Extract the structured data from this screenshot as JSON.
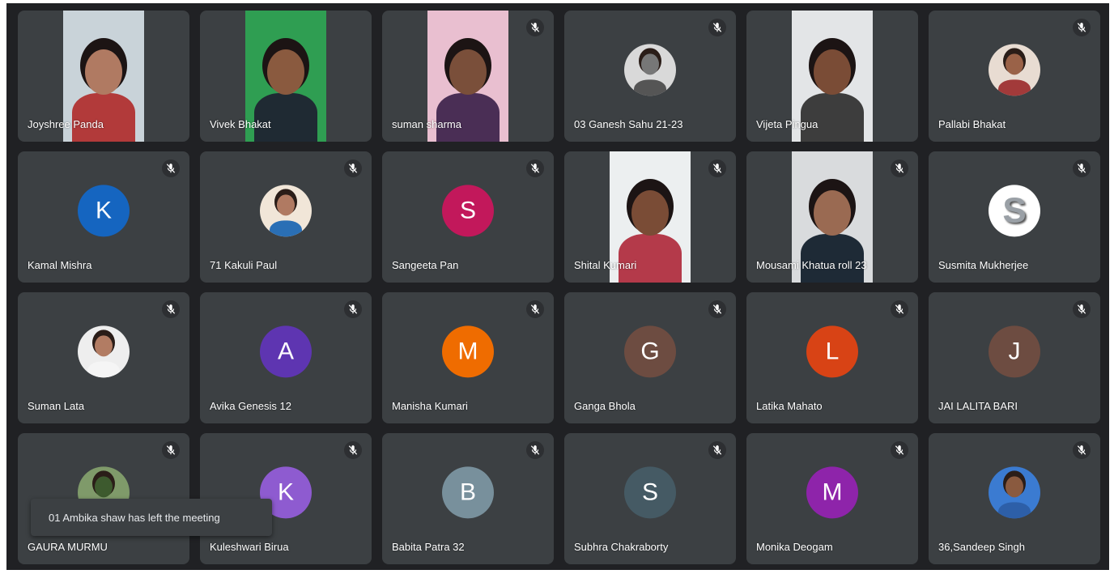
{
  "participants": [
    {
      "name": "Joyshree Panda",
      "type": "video",
      "muted": false,
      "bg": "#c9d3d9",
      "skin": "#b07a62",
      "shirt": "#b23a3a"
    },
    {
      "name": "Vivek Bhakat",
      "type": "video",
      "muted": false,
      "bg": "#2f9e52",
      "skin": "#8a5a3f",
      "shirt": "#1f2a33"
    },
    {
      "name": "suman sharma",
      "type": "video",
      "muted": true,
      "bg": "#e9bfd0",
      "skin": "#7a4f3a",
      "shirt": "#4a2e55"
    },
    {
      "name": "03 Ganesh Sahu 21-23",
      "type": "photo",
      "muted": true,
      "bg": "#d9d9d9",
      "skin": "#777777",
      "shirt": "#555555"
    },
    {
      "name": "Vijeta Pingua",
      "type": "video",
      "muted": false,
      "bg": "#e3e5e7",
      "skin": "#7a4c36",
      "shirt": "#3d3d3d"
    },
    {
      "name": "Pallabi Bhakat",
      "type": "photo",
      "muted": true,
      "bg": "#e8dcd2",
      "skin": "#9a6248",
      "shirt": "#a23a3a"
    },
    {
      "name": "Kamal Mishra",
      "type": "initial",
      "initial": "K",
      "color": "#1565c0",
      "muted": true
    },
    {
      "name": "71 Kakuli Paul",
      "type": "photo",
      "muted": true,
      "bg": "#f1e6d8",
      "skin": "#b07a62",
      "shirt": "#2a6fb5"
    },
    {
      "name": "Sangeeta Pan",
      "type": "initial",
      "initial": "S",
      "color": "#c2185b",
      "muted": true
    },
    {
      "name": "Shital Kumari",
      "type": "video",
      "muted": true,
      "bg": "#eceff0",
      "skin": "#7a4c36",
      "shirt": "#b43a4a"
    },
    {
      "name": "Mousami Khatua roll 23",
      "type": "video",
      "muted": true,
      "bg": "#d9dbdd",
      "skin": "#9a6a52",
      "shirt": "#1e2a36"
    },
    {
      "name": "Susmita Mukherjee",
      "type": "logo",
      "initial": "S",
      "muted": true
    },
    {
      "name": "Suman Lata",
      "type": "photo",
      "muted": true,
      "bg": "#eeeeee",
      "skin": "#b27c63",
      "shirt": "#f5f5f5"
    },
    {
      "name": "Avika Genesis 12",
      "type": "initial",
      "initial": "A",
      "color": "#5e35b1",
      "muted": true
    },
    {
      "name": "Manisha Kumari",
      "type": "initial",
      "initial": "M",
      "color": "#ef6c00",
      "muted": true
    },
    {
      "name": "Ganga Bhola",
      "type": "initial",
      "initial": "G",
      "color": "#6d4c41",
      "muted": true
    },
    {
      "name": "Latika Mahato",
      "type": "initial",
      "initial": "L",
      "color": "#d84315",
      "muted": true
    },
    {
      "name": "JAI LALITA BARI",
      "type": "initial",
      "initial": "J",
      "color": "#6d4c41",
      "muted": true
    },
    {
      "name": "GAURA MURMU",
      "type": "photo",
      "muted": true,
      "bg": "#7f9a6a",
      "skin": "#3d5a2e",
      "shirt": "#4d6b3a"
    },
    {
      "name": "Kuleshwari Birua",
      "type": "initial",
      "initial": "K",
      "color": "#8e5bd0",
      "muted": true
    },
    {
      "name": "Babita Patra 32",
      "type": "initial",
      "initial": "B",
      "color": "#78909c",
      "muted": true
    },
    {
      "name": "Subhra Chakraborty",
      "type": "initial",
      "initial": "S",
      "color": "#455a64",
      "muted": true
    },
    {
      "name": "Monika Deogam",
      "type": "initial",
      "initial": "M",
      "color": "#8e24aa",
      "muted": true
    },
    {
      "name": "36,Sandeep Singh",
      "type": "photo",
      "muted": true,
      "bg": "#3b7bd1",
      "skin": "#8a5a3f",
      "shirt": "#2d5fa8"
    }
  ],
  "notification": {
    "text": "01 Ambika shaw has left the meeting"
  },
  "icons": {
    "mic_muted": "mic-off-icon"
  }
}
